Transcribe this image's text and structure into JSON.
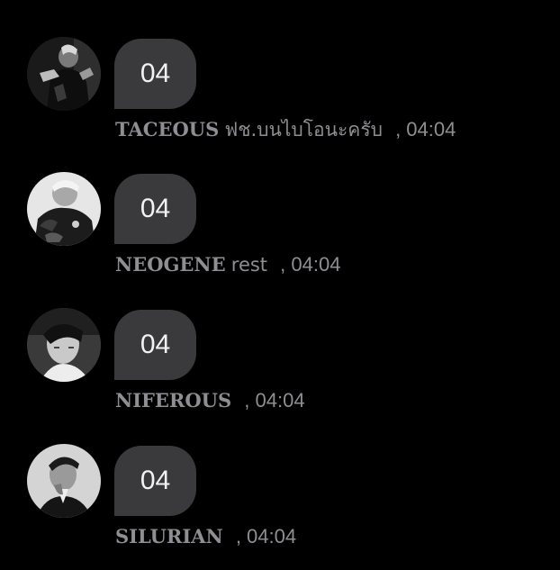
{
  "messages": [
    {
      "bubble_text": "04",
      "sender": "TACEOUS",
      "status": "ฟช.บนไบโอนะครับ",
      "time": ", 04:04"
    },
    {
      "bubble_text": "04",
      "sender": "NEOGENE",
      "status": "rest",
      "time": ", 04:04"
    },
    {
      "bubble_text": "04",
      "sender": "NIFEROUS",
      "status": "",
      "time": ", 04:04"
    },
    {
      "bubble_text": "04",
      "sender": "SILURIAN",
      "status": "",
      "time": ", 04:04"
    }
  ],
  "colors": {
    "background": "#000000",
    "bubble": "#3a3a3c",
    "bubble_text": "#f2f2f2",
    "meta_text": "#8e8e93"
  }
}
